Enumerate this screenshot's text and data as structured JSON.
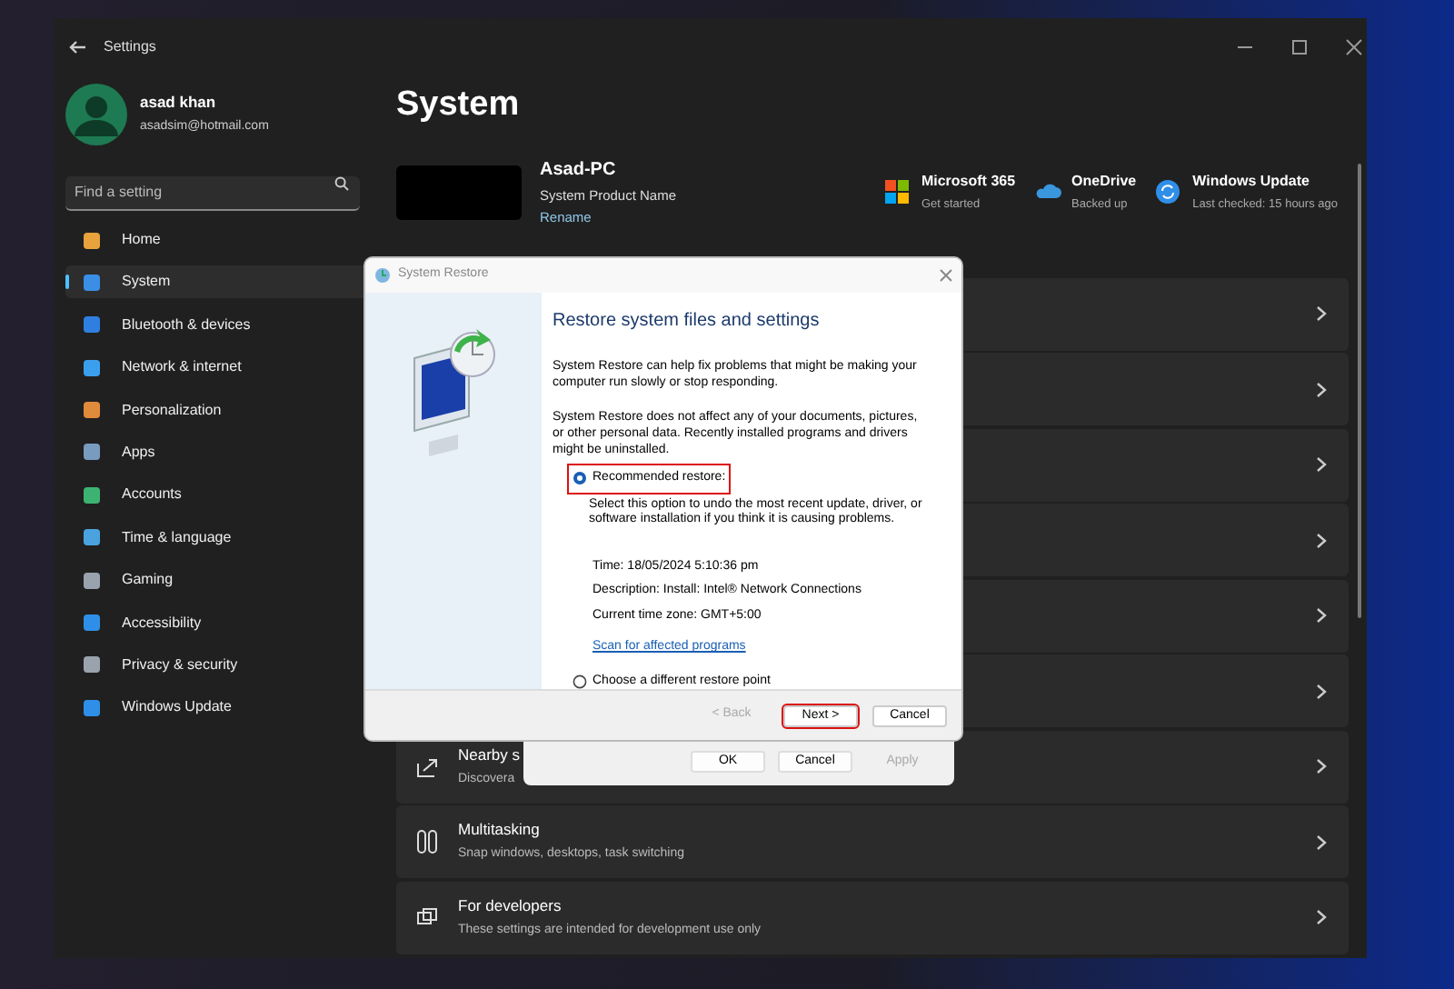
{
  "window": {
    "title": "Settings"
  },
  "user": {
    "name": "asad khan",
    "email": "asadsim@hotmail.com"
  },
  "search": {
    "placeholder": "Find a setting"
  },
  "nav": [
    {
      "label": "Home",
      "selected": false
    },
    {
      "label": "System",
      "selected": true
    },
    {
      "label": "Bluetooth & devices",
      "selected": false
    },
    {
      "label": "Network & internet",
      "selected": false
    },
    {
      "label": "Personalization",
      "selected": false
    },
    {
      "label": "Apps",
      "selected": false
    },
    {
      "label": "Accounts",
      "selected": false
    },
    {
      "label": "Time & language",
      "selected": false
    },
    {
      "label": "Gaming",
      "selected": false
    },
    {
      "label": "Accessibility",
      "selected": false
    },
    {
      "label": "Privacy & security",
      "selected": false
    },
    {
      "label": "Windows Update",
      "selected": false
    }
  ],
  "page": {
    "title": "System",
    "device": {
      "name": "Asad-PC",
      "model": "System Product Name",
      "link": "Rename"
    },
    "services": [
      {
        "name": "Microsoft 365",
        "status": "Get started"
      },
      {
        "name": "OneDrive",
        "status": "Backed up"
      },
      {
        "name": "Windows Update",
        "status": "Last checked: 15 hours ago"
      }
    ]
  },
  "rows": [
    {
      "kind": "covered"
    },
    {
      "kind": "covered"
    },
    {
      "kind": "covered"
    },
    {
      "kind": "covered"
    },
    {
      "kind": "covered"
    },
    {
      "kind": "covered"
    },
    {
      "kind": "partial",
      "title": "Nearby s",
      "subtitle": "Discovera"
    },
    {
      "kind": "full",
      "title": "Multitasking",
      "subtitle": "Snap windows, desktops, task switching"
    },
    {
      "kind": "full",
      "title": "For developers",
      "subtitle": "These settings are intended for development use only"
    }
  ],
  "dialog": {
    "title": "System Restore",
    "heading": "Restore system files and settings",
    "paragraphs": [
      "System Restore can help fix problems that might be making your computer run slowly or stop responding.",
      "System Restore does not affect any of your documents, pictures, or other personal data. Recently installed programs and drivers might be uninstalled."
    ],
    "options": [
      {
        "label": "Recommended restore:",
        "selected": true,
        "highlighted": true,
        "description": "Select this option to undo the most recent update, driver, or software installation if you think it is causing problems.",
        "details": [
          "Time: 18/05/2024 5:10:36 pm",
          "Description: Install: Intel® Network Connections",
          "Current time zone: GMT+5:00"
        ],
        "link": "Scan for affected programs"
      },
      {
        "label": "Choose a different restore point",
        "selected": false,
        "highlighted": false
      }
    ],
    "buttons": [
      {
        "label": "< Back",
        "disabled": true,
        "highlighted": false
      },
      {
        "label": "Next >",
        "disabled": false,
        "highlighted": true
      },
      {
        "label": "Cancel",
        "disabled": false,
        "highlighted": false
      }
    ]
  },
  "back_dialog": {
    "buttons": [
      {
        "label": "OK",
        "disabled": false
      },
      {
        "label": "Cancel",
        "disabled": false
      },
      {
        "label": "Apply",
        "disabled": true
      }
    ]
  }
}
